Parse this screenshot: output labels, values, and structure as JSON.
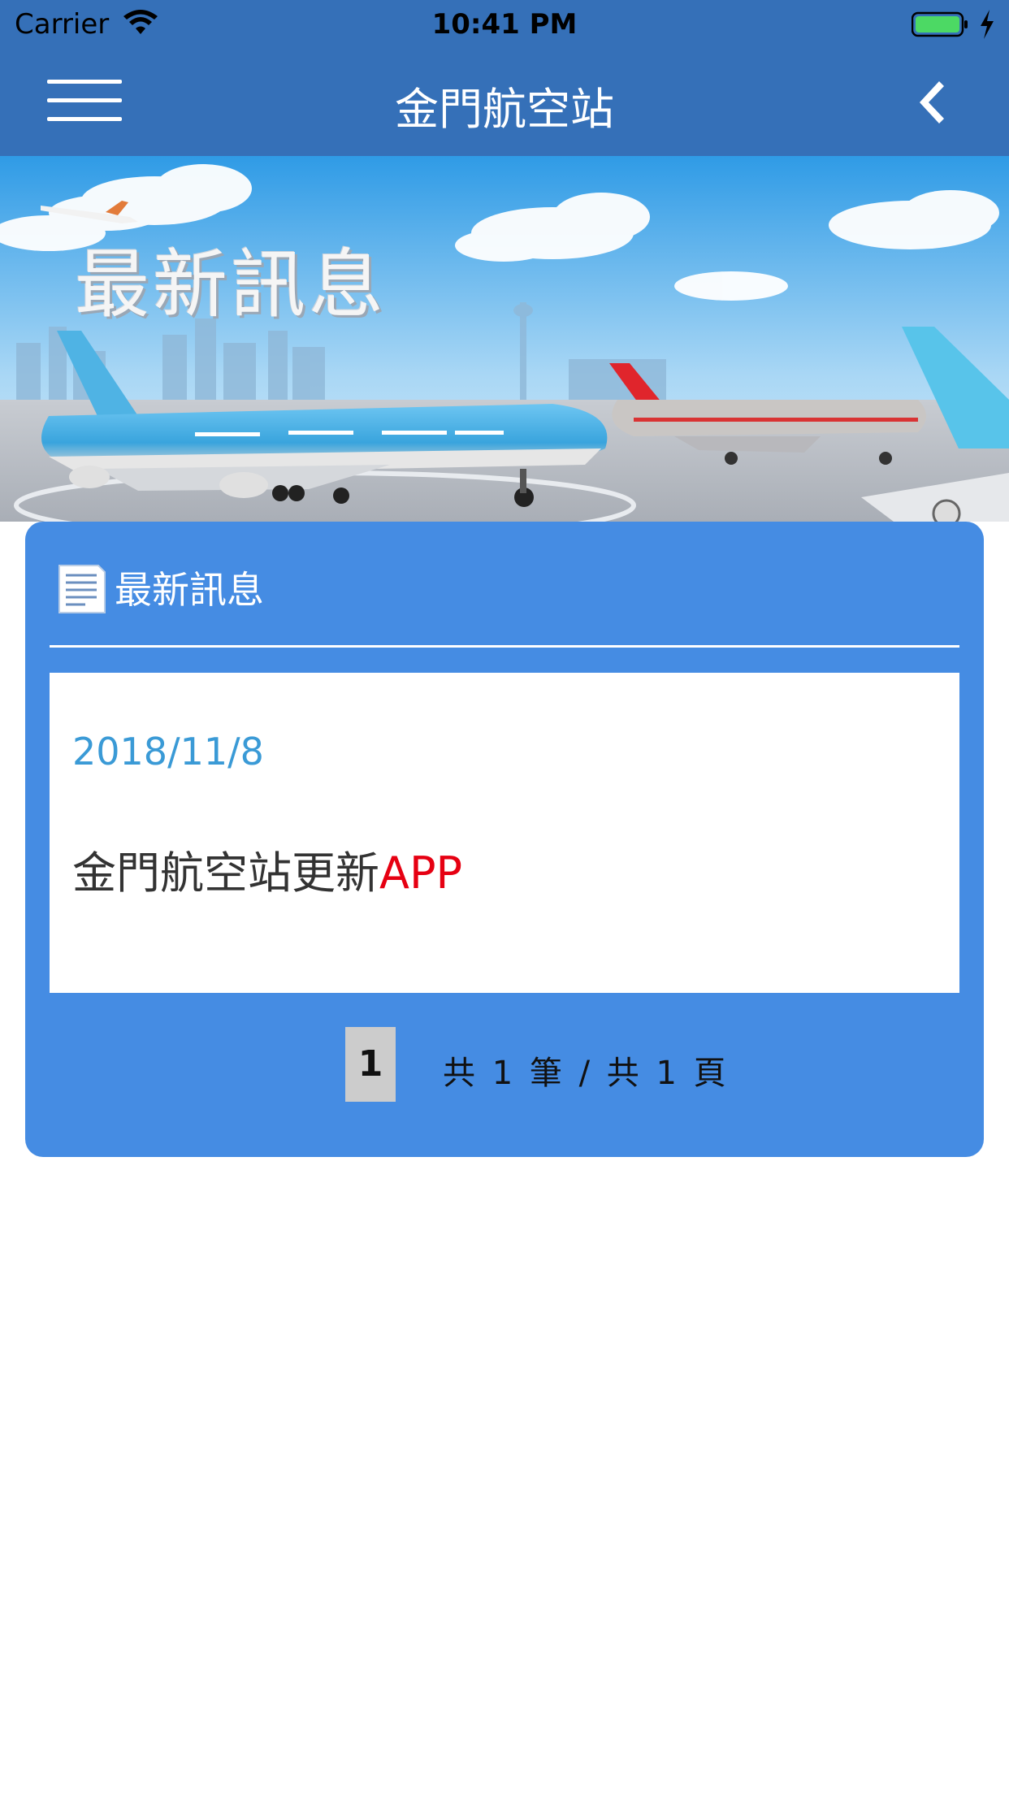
{
  "status_bar": {
    "carrier": "Carrier",
    "time": "10:41 PM",
    "icons": [
      "wifi-icon",
      "battery-icon",
      "charging-bolt-icon"
    ]
  },
  "nav": {
    "title": "金門航空站",
    "menu_icon": "hamburger-menu-icon",
    "back_icon": "chevron-left-icon"
  },
  "banner": {
    "title": "最新訊息"
  },
  "news_section": {
    "header_icon": "document-icon",
    "header_title": "最新訊息",
    "items": [
      {
        "date": "2018/11/8",
        "title_main": "金門航空站更新",
        "title_highlight": "APP"
      }
    ],
    "pagination": {
      "current_page": "1",
      "summary": "共 1 筆 / 共 1 頁"
    }
  },
  "colors": {
    "nav_bar": "#3570b8",
    "card": "#458ce3",
    "date_text": "#3a9ad6",
    "highlight": "#e60012",
    "page_button": "#cccccc"
  }
}
